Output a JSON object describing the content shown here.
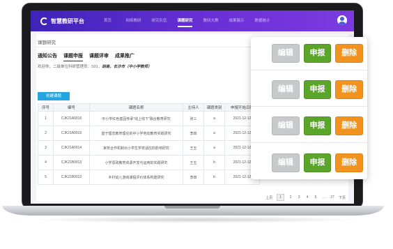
{
  "app": {
    "logo_text": "智慧教研平台"
  },
  "nav": {
    "items": [
      {
        "label": "首页"
      },
      {
        "label": "网络教研"
      },
      {
        "label": "研究队伍"
      },
      {
        "label": "课题研究"
      },
      {
        "label": "教研大赛"
      },
      {
        "label": "成果展示"
      },
      {
        "label": "数据统计"
      }
    ],
    "active_index": 3
  },
  "page": {
    "breadcrumb": "课题研究",
    "tabs": [
      {
        "label": "通知公告"
      },
      {
        "label": "课题申报"
      },
      {
        "label": "课题评审"
      },
      {
        "label": "成果推广"
      }
    ],
    "active_tab": 1,
    "welcome_prefix": "欢迎你，二级单位科研管理员：S01，",
    "welcome_org": "胡南，长沙市（中小学教师）",
    "create_button": "创建课题"
  },
  "table": {
    "headers": [
      "序号",
      "编号",
      "课题名称",
      "主持人",
      "课题类别",
      "申报开始日期"
    ],
    "rows": [
      {
        "no": "1",
        "code": "CJK21A0016",
        "name": "中小学红色基因传承\"线上线下\"融合教育研究",
        "host": "张三",
        "type": "a",
        "date": "2021-12-12"
      },
      {
        "no": "2",
        "code": "CJK21A0015",
        "name": "基于理念教育理论的中小学劳动教育实践研究",
        "host": "李四",
        "type": "a",
        "date": "2021-12-12"
      },
      {
        "no": "3",
        "code": "CJK21A0014",
        "name": "家校合作机制对小学生学校适应的影响研究",
        "host": "王五",
        "type": "a",
        "date": "2021-12-12"
      },
      {
        "no": "4",
        "code": "CJK21B0013",
        "name": "小学思政教育资源开发与运用的实践研究",
        "host": "王五",
        "type": "b",
        "date": "2021-12-12"
      },
      {
        "no": "5",
        "code": "CJK21B0012",
        "name": "乡村幼儿游戏课程评价体系构建研究",
        "host": "李四",
        "type": "b",
        "date": "2021-12-12"
      }
    ]
  },
  "pager": {
    "prev": "上页",
    "pages": [
      "1",
      "2",
      "3",
      "4",
      "5",
      "...",
      "27"
    ],
    "current": "1",
    "next": "下页"
  },
  "actions": {
    "edit_label": "编辑",
    "submit_label": "申报",
    "delete_label": "删除",
    "row_count": 4
  },
  "colors": {
    "nav_gradient_start": "#3d24b8",
    "nav_gradient_end": "#7b3be0",
    "create_button": "#23a6e0",
    "edit_button": "#c8c9cb",
    "submit_button": "#5aa52a",
    "delete_button": "#f1931e"
  },
  "icons": {
    "logo": "logo-mark-icon",
    "avatar": "user-avatar-icon"
  }
}
